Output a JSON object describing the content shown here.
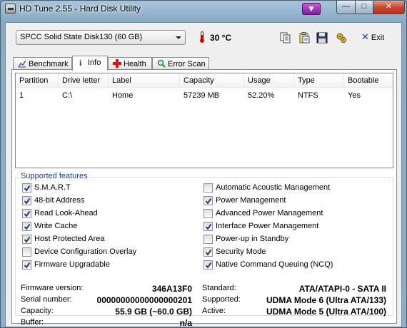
{
  "window": {
    "title": "HD Tune 2.55 - Hard Disk Utility"
  },
  "toolbar": {
    "drive": "SPCC Solid State Disk130 (60 GB)",
    "temperature": "30 °C",
    "exit_label": "Exit",
    "icons": [
      "copy-info-icon",
      "copy-all-icon",
      "save-icon",
      "options-icon",
      "exit-icon"
    ]
  },
  "tabs": [
    {
      "label": "Benchmark",
      "icon": "benchmark-icon"
    },
    {
      "label": "Info",
      "icon": "info-icon",
      "active": true
    },
    {
      "label": "Health",
      "icon": "health-icon"
    },
    {
      "label": "Error Scan",
      "icon": "magnifier-icon"
    }
  ],
  "partitions": {
    "columns": [
      "Partition",
      "Drive letter",
      "Label",
      "Capacity",
      "Usage",
      "Type",
      "Bootable"
    ],
    "rows": [
      [
        "1",
        "C:\\",
        "Home",
        "57239 MB",
        "52.20%",
        "NTFS",
        "Yes"
      ]
    ]
  },
  "supported_features": {
    "title": "Supported features",
    "left": [
      {
        "label": "S.M.A.R.T",
        "checked": true
      },
      {
        "label": "48-bit Address",
        "checked": true
      },
      {
        "label": "Read Look-Ahead",
        "checked": true
      },
      {
        "label": "Write Cache",
        "checked": true
      },
      {
        "label": "Host Protected Area",
        "checked": true
      },
      {
        "label": "Device Configuration Overlay",
        "checked": false
      },
      {
        "label": "Firmware Upgradable",
        "checked": true
      }
    ],
    "right": [
      {
        "label": "Automatic Acoustic Management",
        "checked": false
      },
      {
        "label": "Power Management",
        "checked": true
      },
      {
        "label": "Advanced Power Management",
        "checked": false
      },
      {
        "label": "Interface Power Management",
        "checked": true
      },
      {
        "label": "Power-up in Standby",
        "checked": false
      },
      {
        "label": "Security Mode",
        "checked": true
      },
      {
        "label": "Native Command Queuing (NCQ)",
        "checked": true
      }
    ]
  },
  "details": {
    "left": [
      {
        "key": "Firmware version:",
        "value": "346A13F0"
      },
      {
        "key": "Serial number:",
        "value": "00000000000000000201"
      },
      {
        "key": "Capacity:",
        "value": "55.9 GB (~60.0 GB)"
      },
      {
        "key": "Buffer:",
        "value": "n/a"
      }
    ],
    "right": [
      {
        "key": "Standard:",
        "value": "ATA/ATAPI-0 - SATA II"
      },
      {
        "key": "Supported:",
        "value": "UDMA Mode 6 (Ultra ATA/133)"
      },
      {
        "key": "Active:",
        "value": "UDMA Mode 5 (Ultra ATA/100)"
      }
    ]
  }
}
